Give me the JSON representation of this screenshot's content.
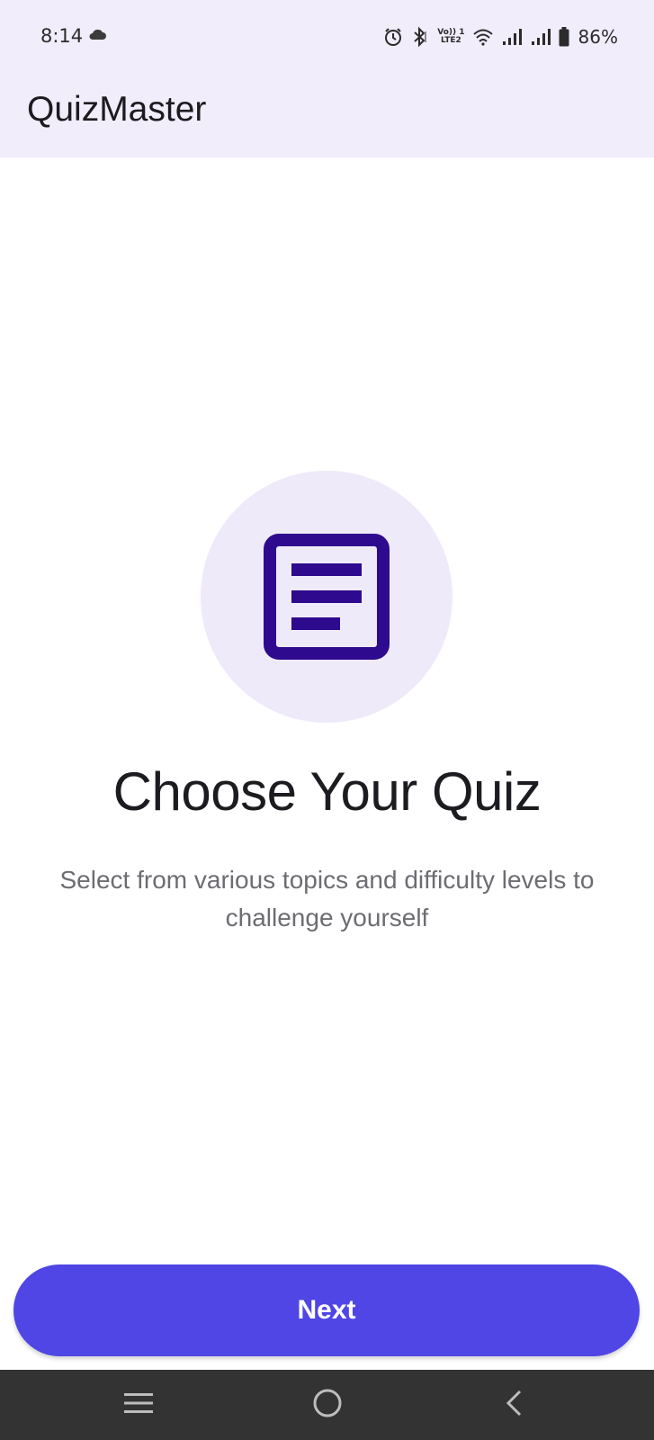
{
  "status_bar": {
    "time": "8:14",
    "battery_percent": "86%",
    "volte_top": "Vo)) 1",
    "volte_bottom": "LTE2",
    "icons": [
      "cloud-icon",
      "alarm-icon",
      "bluetooth-icon",
      "volte-icon",
      "wifi-icon",
      "signal-icon",
      "signal-icon",
      "battery-icon"
    ]
  },
  "app_bar": {
    "title": "QuizMaster"
  },
  "onboarding": {
    "icon": "article-icon",
    "title": "Choose Your Quiz",
    "description": "Select from various topics and difficulty levels to challenge yourself"
  },
  "actions": {
    "next_label": "Next"
  },
  "nav_bar": {
    "icons": [
      "recents-icon",
      "home-icon",
      "back-icon"
    ]
  },
  "colors": {
    "header_bg": "#f1edfb",
    "accent": "#4f46e5",
    "icon_color": "#2e0a8f",
    "circle_bg": "#efeaf9",
    "nav_bg": "#333333"
  }
}
